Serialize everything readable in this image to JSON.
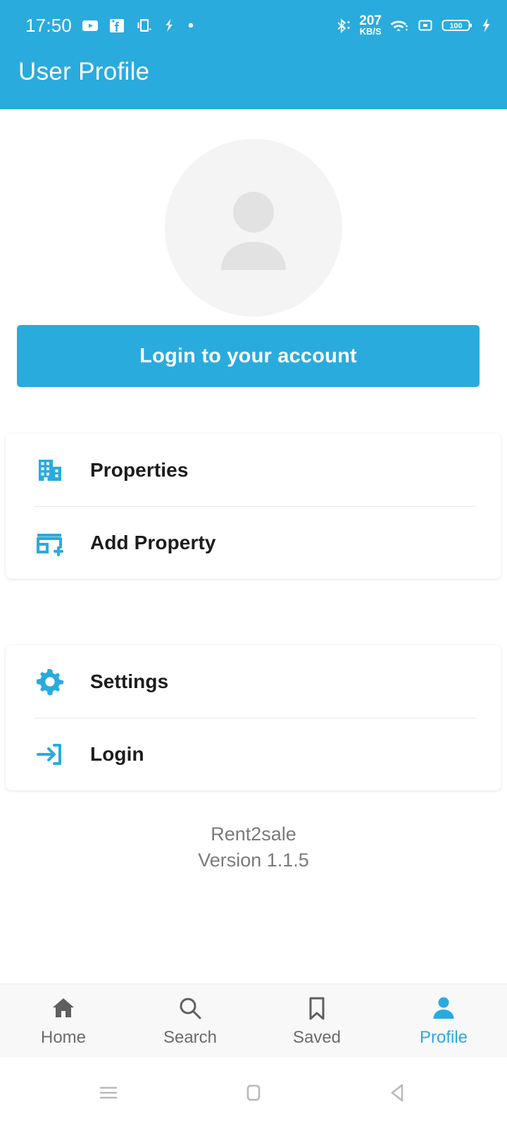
{
  "statusbar": {
    "time": "17:50",
    "left_icons": [
      "youtube-icon",
      "facebook-messenger-icon",
      "app-notification-icon",
      "flash-icon",
      "dot-icon"
    ],
    "network_speed_value": "207",
    "network_speed_unit": "KB/S",
    "right_icons": [
      "bluetooth-icon",
      "wifi-icon",
      "screen-record-icon",
      "battery-icon",
      "charging-bolt-icon"
    ],
    "battery_level": "100"
  },
  "appbar": {
    "title": "User Profile",
    "color": "#2aabdd"
  },
  "profile": {
    "avatar_icon": "person-placeholder-icon",
    "avatar_bg": "#f4f4f4",
    "avatar_fg": "#e2e2e2",
    "login_button_label": "Login to your account"
  },
  "menu_cards": [
    {
      "id": "property-card",
      "items": [
        {
          "label": "Properties",
          "icon": "buildings-icon"
        },
        {
          "label": "Add Property",
          "icon": "add-store-icon"
        }
      ]
    },
    {
      "id": "account-card",
      "items": [
        {
          "label": "Settings",
          "icon": "gear-icon"
        },
        {
          "label": "Login",
          "icon": "login-arrow-icon"
        }
      ]
    }
  ],
  "app_info": {
    "name": "Rent2sale",
    "version": "Version 1.1.5"
  },
  "bottom_nav": {
    "items": [
      {
        "label": "Home",
        "icon": "home-icon",
        "active": false
      },
      {
        "label": "Search",
        "icon": "search-icon",
        "active": false
      },
      {
        "label": "Saved",
        "icon": "bookmark-icon",
        "active": false
      },
      {
        "label": "Profile",
        "icon": "person-icon",
        "active": true
      }
    ],
    "active_color": "#2aabdd",
    "inactive_color": "#6b6b6b"
  },
  "system_nav": {
    "buttons": [
      "recents-icon",
      "home-square-icon",
      "back-triangle-icon"
    ]
  },
  "theme": {
    "accent": "#2aabdd",
    "icon_blue": "#2aabdd",
    "text_primary": "#1c1c1c",
    "text_muted": "#7a7a7a"
  }
}
